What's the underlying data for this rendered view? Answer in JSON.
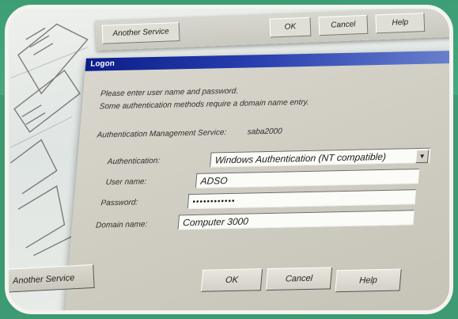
{
  "back_window": {
    "another_service": "Another Service",
    "ok": "OK",
    "cancel": "Cancel",
    "help": "Help"
  },
  "dialog": {
    "title": "Logon",
    "close": "×",
    "instruction_1": "Please enter user name and password.",
    "instruction_2": "Some authentication methods require a domain name entry.",
    "service_label": "Authentication Management Service:",
    "service_value": "saba2000",
    "labels": {
      "authentication": "Authentication:",
      "user_name": "User name:",
      "password": "Password:",
      "domain_name": "Domain name:"
    },
    "authentication_value": "Windows Authentication (NT compatible)",
    "user_name_value": "ADSO",
    "password_value": "••••••••••••",
    "domain_name_value": "Computer 3000",
    "ok_label": "OK",
    "cancel_label": "Cancel",
    "help_label": "Help",
    "another_service_label": "Another Service"
  },
  "colors": {
    "background_green": "#3e9a73",
    "titlebar": "#0b1d8a",
    "frame": "#f4f4ef"
  }
}
